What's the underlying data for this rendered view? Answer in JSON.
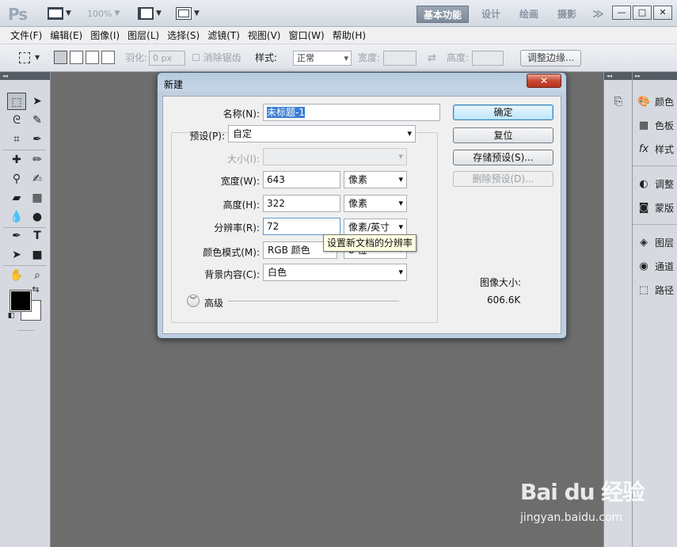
{
  "app": {
    "logo": "Ps",
    "zoom": "100%"
  },
  "workspaces": [
    "基本功能",
    "设计",
    "绘画",
    "摄影"
  ],
  "workspaces_more": "≫",
  "window_controls": [
    "—",
    "□",
    "✕"
  ],
  "menu": [
    "文件(F)",
    "编辑(E)",
    "图像(I)",
    "图层(L)",
    "选择(S)",
    "滤镜(T)",
    "视图(V)",
    "窗口(W)",
    "帮助(H)"
  ],
  "options": {
    "feather_label": "羽化:",
    "feather_value": "0 px",
    "antialias_label": "消除锯齿",
    "style_label": "样式:",
    "style_value": "正常",
    "width_label": "宽度:",
    "height_label": "高度:",
    "refine_button": "调整边缘..."
  },
  "right_panel": {
    "items": [
      "颜色",
      "色板",
      "样式",
      "调整",
      "蒙版",
      "图层",
      "通道",
      "路径"
    ]
  },
  "dialog": {
    "title": "新建",
    "close_label": "✕",
    "name_label": "名称(N):",
    "name_value": "未标题-1",
    "preset_label": "预设(P):",
    "preset_value": "自定",
    "size_label": "大小(I):",
    "size_value": "",
    "width_label": "宽度(W):",
    "width_value": "643",
    "width_unit": "像素",
    "height_label": "高度(H):",
    "height_value": "322",
    "height_unit": "像素",
    "resolution_label": "分辨率(R):",
    "resolution_value": "72",
    "resolution_unit": "像素/英寸",
    "color_mode_label": "颜色模式(M):",
    "color_mode_value": "RGB 颜色",
    "color_depth_value": "8 位",
    "background_label": "背景内容(C):",
    "background_value": "白色",
    "advanced_label": "高级",
    "tooltip": "设置新文档的分辨率",
    "ok_button": "确定",
    "reset_button": "复位",
    "save_preset_button": "存储预设(S)...",
    "delete_preset_button": "删除预设(D)...",
    "image_size_label": "图像大小:",
    "image_size_value": "606.6K"
  },
  "watermark": {
    "logo": "Bai du 经验",
    "url": "jingyan.baidu.com"
  }
}
